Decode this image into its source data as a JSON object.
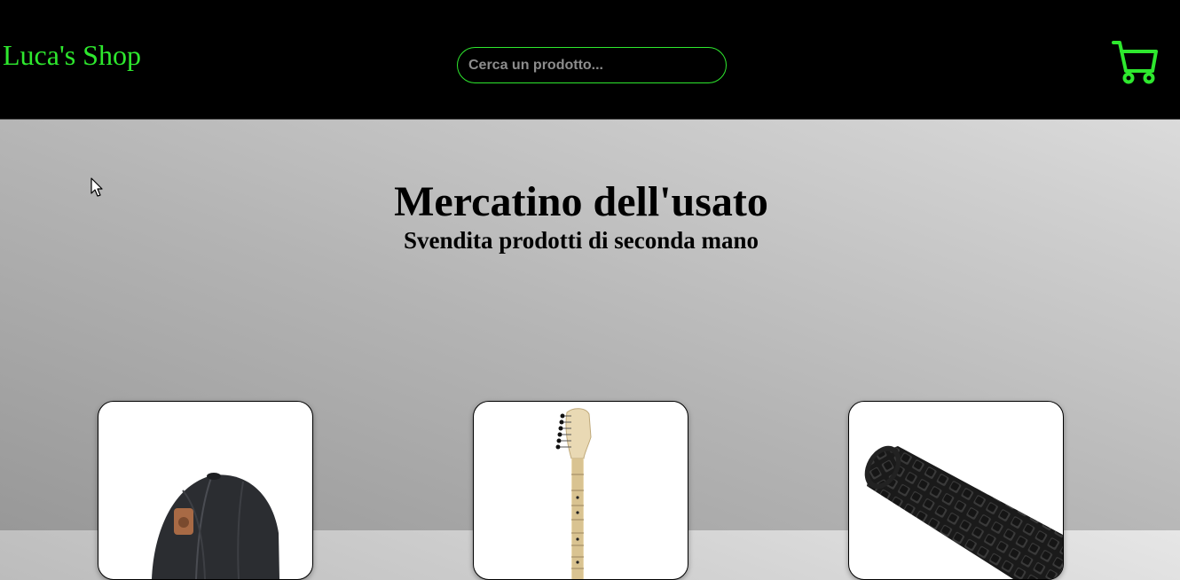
{
  "header": {
    "brand": "Luca's Shop",
    "search_placeholder": "Cerca un prodotto...",
    "cart_icon": "shopping-cart-icon",
    "accent_color": "#2ee82e"
  },
  "hero": {
    "title": "Mercatino dell'usato",
    "subtitle": "Svendita prodotti di seconda mano"
  },
  "products": [
    {
      "image": "cap-image"
    },
    {
      "image": "guitar-image"
    },
    {
      "image": "foam-roller-image"
    }
  ]
}
